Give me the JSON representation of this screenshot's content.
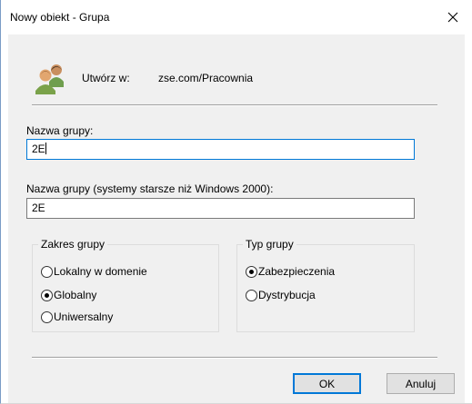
{
  "window": {
    "title": "Nowy obiekt - Grupa",
    "close_icon": "close-icon",
    "accent": "#0078d7"
  },
  "header": {
    "icon": "users-group-icon",
    "create_in_label": "Utwórz w:",
    "create_in_value": "zse.com/Pracownia"
  },
  "group_name": {
    "label": "Nazwa grupy:",
    "value": "2E"
  },
  "group_name_legacy": {
    "label": "Nazwa grupy (systemy starsze niż Windows 2000):",
    "value": "2E"
  },
  "group_scope": {
    "title": "Zakres grupy",
    "options": [
      {
        "label": "Lokalny w domenie",
        "checked": false
      },
      {
        "label": "Globalny",
        "checked": true
      },
      {
        "label": "Uniwersalny",
        "checked": false
      }
    ]
  },
  "group_type": {
    "title": "Typ grupy",
    "options": [
      {
        "label": "Zabezpieczenia",
        "checked": true
      },
      {
        "label": "Dystrybucja",
        "checked": false
      }
    ]
  },
  "buttons": {
    "ok": "OK",
    "cancel": "Anuluj"
  }
}
